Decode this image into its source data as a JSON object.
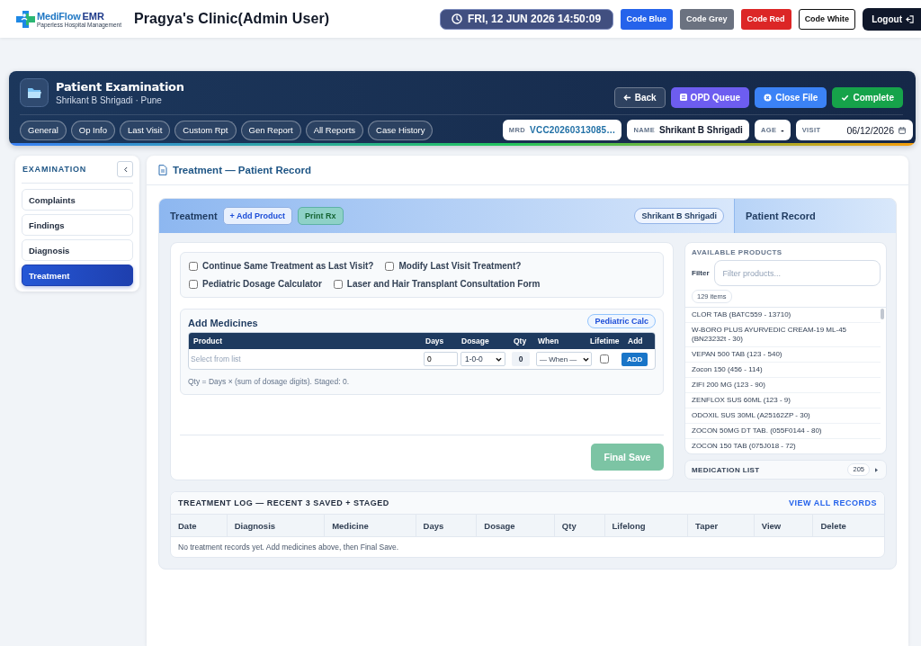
{
  "header": {
    "logo": {
      "name": "MediFlow",
      "suffix": "EMR",
      "tagline": "Paperless Hospital Management"
    },
    "clinic_title": "Pragya's Clinic(Admin User)",
    "datetime": "FRI, 12 JUN 2026 14:50:09",
    "code_buttons": [
      {
        "label": "Code Blue",
        "color": "#2563eb"
      },
      {
        "label": "Code Grey",
        "color": "#6b7280"
      },
      {
        "label": "Code Red",
        "color": "#dc2626"
      },
      {
        "label": "Code White",
        "color": "#ffffff"
      }
    ],
    "logout": "Logout"
  },
  "patient_header": {
    "title": "Patient Examination",
    "subtitle": "Shrikant B Shrigadi · Pune",
    "actions": [
      {
        "label": "Back",
        "kind": "back"
      },
      {
        "label": "OPD Queue",
        "kind": "queue"
      },
      {
        "label": "Close File",
        "kind": "close"
      },
      {
        "label": "Complete",
        "kind": "complete"
      }
    ],
    "tabs": [
      {
        "label": "General",
        "selected": false
      },
      {
        "label": "Op Info",
        "selected": false
      },
      {
        "label": "Last Visit",
        "selected": false
      },
      {
        "label": "Custom Rpt",
        "selected": false
      },
      {
        "label": "Gen Report",
        "selected": false
      },
      {
        "label": "All Reports",
        "selected": false
      },
      {
        "label": "Case History",
        "selected": false
      }
    ],
    "info": [
      {
        "label": "MRD",
        "value": "VCC20260313085…",
        "kind": "code"
      },
      {
        "label": "NAME",
        "value": "Shrikant B Shrigadi",
        "kind": "text"
      },
      {
        "label": "AGE",
        "value": "-",
        "kind": "text"
      },
      {
        "label": "VISIT",
        "value": "06/12/2026",
        "kind": "date"
      }
    ]
  },
  "sidebar": {
    "title": "EXAMINATION",
    "items": [
      {
        "label": "Complaints",
        "selected": false
      },
      {
        "label": "Findings",
        "selected": false
      },
      {
        "label": "Diagnosis",
        "selected": false
      },
      {
        "label": "Treatment",
        "selected": true
      }
    ]
  },
  "main": {
    "title": "Treatment — Patient Record",
    "treatment_bar": {
      "title": "Treatment",
      "buttons": [
        {
          "label": "+ Add Product",
          "kind": "outline"
        },
        {
          "label": "Print Rx",
          "kind": "teal"
        }
      ],
      "patient": "Shrikant B Shrigadi",
      "side_title": "Patient Record"
    },
    "options": [
      {
        "label": "Continue Same Treatment as Last Visit?",
        "checked": false
      },
      {
        "label": "Modify Last Visit Treatment?",
        "checked": false
      },
      {
        "label": "Pediatric Dosage Calculator",
        "checked": false
      },
      {
        "label": "Laser and Hair Transplant Consultation Form",
        "checked": false
      }
    ],
    "add_medicines": {
      "title": "Add Medicines",
      "calc_button": "Pediatric Calc",
      "columns": [
        "Product",
        "Days",
        "Dosage",
        "Qty",
        "When",
        "Lifetime",
        "Add"
      ],
      "entry": {
        "product": {
          "placeholder": "Select from list"
        },
        "days": "0",
        "dosage": "1-0-0",
        "qty": "0",
        "when": "— When —",
        "lifetime": false,
        "add_button": "ADD"
      },
      "hint": "Qty = Days × (sum of dosage digits). Staged: 0."
    },
    "final_save": {
      "label": "Final Save",
      "disabled": true
    },
    "products": {
      "title": "AVAILABLE PRODUCTS",
      "filter_label": "Filter",
      "filter": {
        "placeholder": "Filter products..."
      },
      "count": "129 items",
      "items": [
        "CLOR TAB (BATC559 - 13710)",
        "W-BORO PLUS AYURVEDIC CREAM-19 ML-45 (BN23232t - 30)",
        "VEPAN 500 TAB (123 - 540)",
        "Zocon 150 (456 - 114)",
        "ZIFI 200 MG (123 - 90)",
        "ZENFLOX SUS 60ML (123 - 9)",
        "ODOXIL SUS 30ML (A25162ZP - 30)",
        "ZOCON 50MG DT TAB. (055F0144 - 80)",
        "ZOCON 150 TAB (075J018 - 72)"
      ]
    },
    "medication_list": {
      "title": "MEDICATION LIST",
      "count": "205"
    },
    "treatment_log": {
      "title": "TREATMENT LOG — RECENT 3 SAVED + STAGED",
      "link": "VIEW ALL RECORDS",
      "columns": [
        "Date",
        "Diagnosis",
        "Medicine",
        "Days",
        "Dosage",
        "Qty",
        "Lifelong",
        "Taper",
        "View",
        "Delete"
      ],
      "empty_message": "No treatment records yet. Add medicines above, then Final Save."
    }
  }
}
